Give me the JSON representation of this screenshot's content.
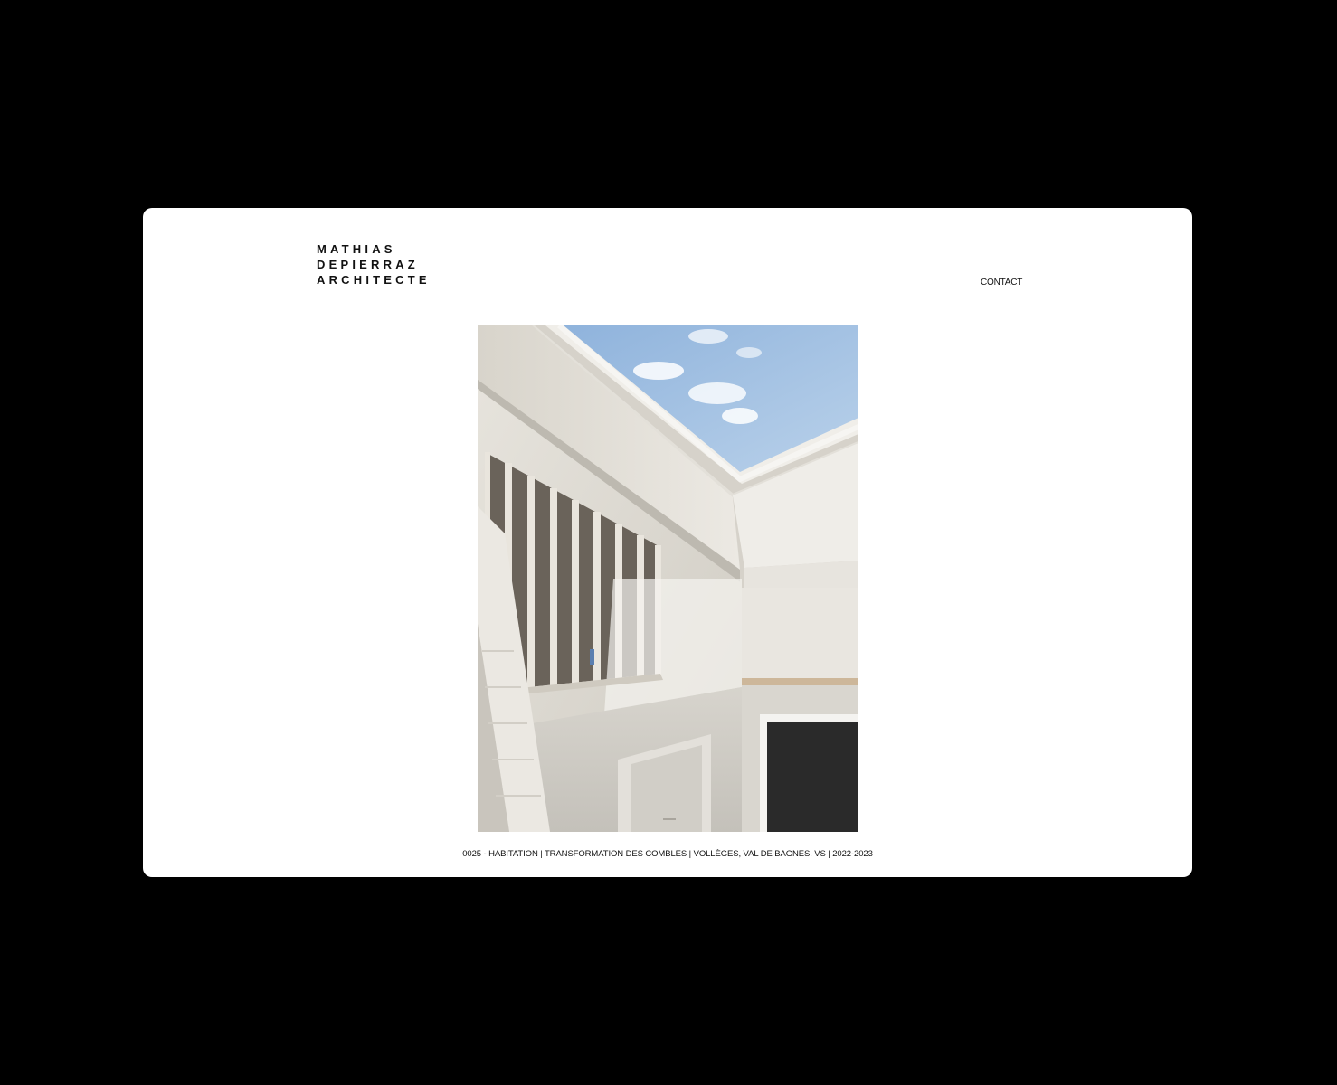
{
  "header": {
    "logo_lines": [
      "MATHIAS",
      "DEPIERRAZ",
      "ARCHITECTE"
    ],
    "nav": {
      "contact_label": "CONTACT"
    }
  },
  "main": {
    "photo": {
      "subject": "interior attic staircase under roof skylight"
    },
    "caption": "0025 - HABITATION | TRANSFORMATION DES COMBLES | VOLLÈGES, VAL DE BAGNES, VS | 2022-2023"
  }
}
